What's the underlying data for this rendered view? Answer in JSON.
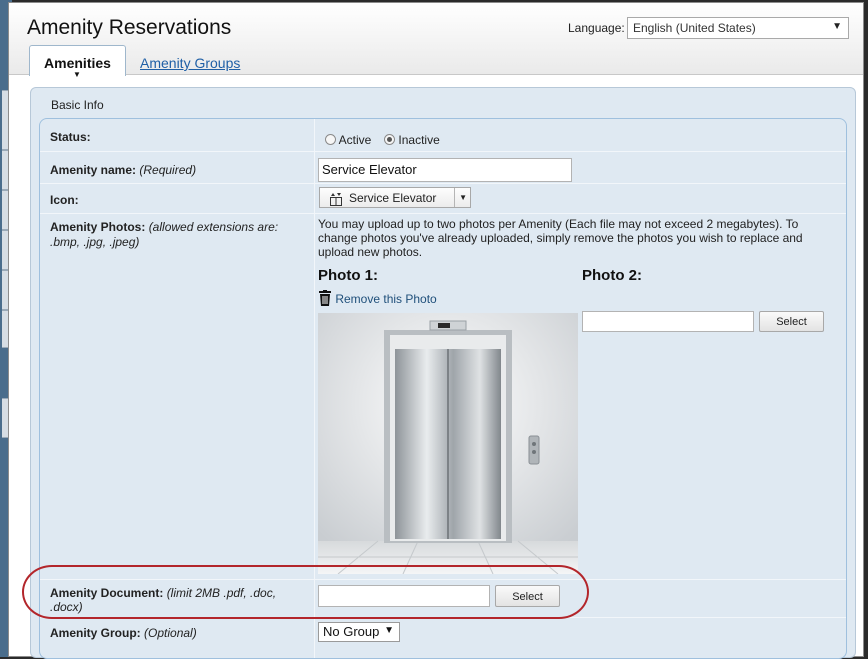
{
  "app": {
    "title": "Amenity Reservations",
    "language_label": "Language:",
    "language_value": "English (United States)"
  },
  "tabs": [
    {
      "label": "Amenities",
      "active": true
    },
    {
      "label": "Amenity Groups",
      "active": false
    }
  ],
  "section": {
    "title": "Basic Info"
  },
  "form": {
    "status": {
      "label": "Status:",
      "options": [
        "Active",
        "Inactive"
      ],
      "selected": "Inactive"
    },
    "name": {
      "label": "Amenity name:",
      "hint": "(Required)",
      "value": "Service Elevator"
    },
    "icon": {
      "label": "Icon:",
      "selected": "Service Elevator",
      "icon_name": "elevator-icon"
    },
    "photos": {
      "label": "Amenity Photos:",
      "hint": "(allowed extensions are: .bmp, .jpg, .jpeg)",
      "description": "You may upload up to two photos per Amenity (Each file may not exceed 2 megabytes). To change photos you've already uploaded, simply remove the photos you wish to replace and upload new photos.",
      "photo1_title": "Photo 1:",
      "remove_label": "Remove this Photo",
      "photo2_title": "Photo 2:",
      "photo2_value": "",
      "select_label": "Select"
    },
    "document": {
      "label": "Amenity Document:",
      "hint": "(limit 2MB .pdf, .doc, .docx)",
      "value": "",
      "select_label": "Select"
    },
    "group": {
      "label": "Amenity Group:",
      "hint": "(Optional)",
      "selected": "No Group"
    }
  },
  "colors": {
    "panel_bg": "#dfe9f2",
    "panel_border": "#9fc0de",
    "link": "#1f5fa6",
    "annotation": "#b3262b"
  }
}
